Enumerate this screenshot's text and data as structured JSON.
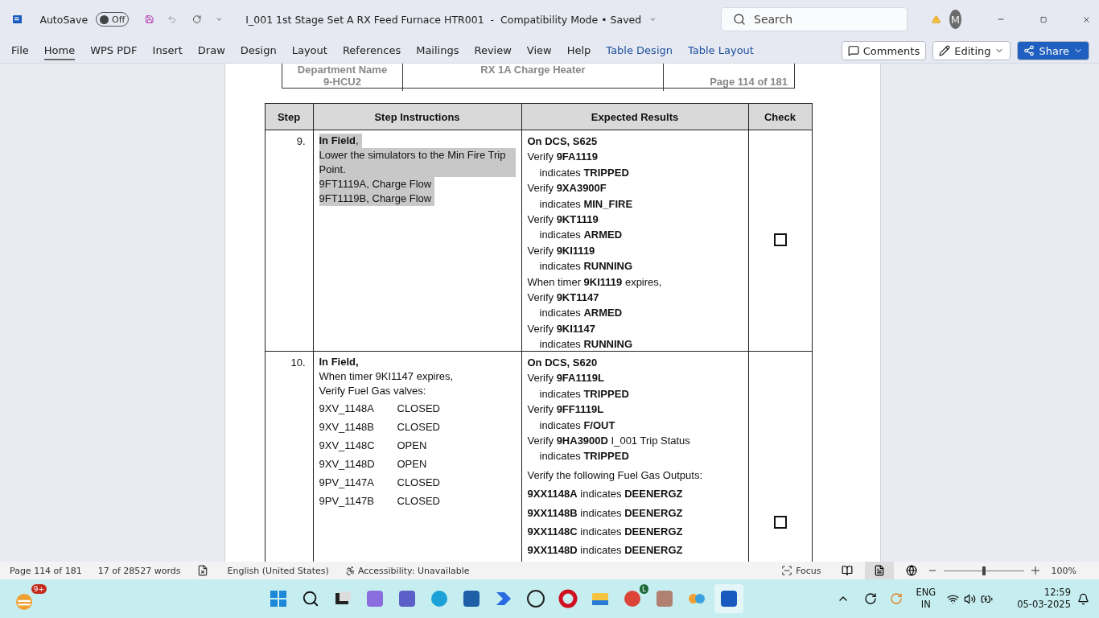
{
  "title_bar": {
    "autosave_label": "AutoSave",
    "autosave_on": false,
    "autosave_state": "Off",
    "document_title": "I_001 1st Stage Set A RX Feed Furnace HTR001  -  Compatibility Mode • Saved",
    "search_placeholder": "Search",
    "avatar": "M"
  },
  "ribbon": {
    "tabs": [
      {
        "label": "File",
        "selected": false,
        "kind": "core"
      },
      {
        "label": "Home",
        "selected": true,
        "kind": "core"
      },
      {
        "label": "WPS PDF",
        "selected": false,
        "kind": "core"
      },
      {
        "label": "Insert",
        "selected": false,
        "kind": "core"
      },
      {
        "label": "Draw",
        "selected": false,
        "kind": "core"
      },
      {
        "label": "Design",
        "selected": false,
        "kind": "core"
      },
      {
        "label": "Layout",
        "selected": false,
        "kind": "core"
      },
      {
        "label": "References",
        "selected": false,
        "kind": "core"
      },
      {
        "label": "Mailings",
        "selected": false,
        "kind": "core"
      },
      {
        "label": "Review",
        "selected": false,
        "kind": "core"
      },
      {
        "label": "View",
        "selected": false,
        "kind": "core"
      },
      {
        "label": "Help",
        "selected": false,
        "kind": "core"
      },
      {
        "label": "Table Design",
        "selected": false,
        "kind": "contextual"
      },
      {
        "label": "Table Layout",
        "selected": false,
        "kind": "contextual"
      }
    ],
    "comments": "Comments",
    "editing": "Editing",
    "share": "Share"
  },
  "header_block": {
    "department_label": "Department Name",
    "department_value": "9-HCU2",
    "title": "RX 1A Charge Heater",
    "page": "Page 114 of 181"
  },
  "table": {
    "columns": [
      "Step",
      "Step Instructions",
      "Expected Results",
      "Check"
    ],
    "rows": [
      {
        "step": "9.",
        "checked": false,
        "instructions": [
          {
            "kind": "text",
            "text": "**In Field**,",
            "highlighted": true
          },
          {
            "kind": "text",
            "text": "Lower the simulators to the Min Fire Trip Point.",
            "highlighted": true
          },
          {
            "kind": "text",
            "text": "9FT1119A, Charge Flow",
            "highlighted": true
          },
          {
            "kind": "text",
            "text": "9FT1119B, Charge Flow",
            "highlighted": true
          }
        ],
        "results": [
          {
            "kind": "line",
            "text": "**On DCS, S625**"
          },
          {
            "kind": "line",
            "text": "Verify **9FA1119**"
          },
          {
            "kind": "sub",
            "text": "indicates **TRIPPED**"
          },
          {
            "kind": "line",
            "text": "Verify **9XA3900F**"
          },
          {
            "kind": "sub",
            "text": "indicates **MIN_FIRE**"
          },
          {
            "kind": "line",
            "text": "Verify **9KT1119**"
          },
          {
            "kind": "sub",
            "text": "indicates **ARMED**"
          },
          {
            "kind": "line",
            "text": "Verify **9KI1119**"
          },
          {
            "kind": "sub",
            "text": "indicates **RUNNING**"
          },
          {
            "kind": "line",
            "text": "When timer **9KI1119** expires,"
          },
          {
            "kind": "line",
            "text": "Verify **9KT1147**"
          },
          {
            "kind": "sub",
            "text": "indicates **ARMED**"
          },
          {
            "kind": "line",
            "text": "Verify **9KI1147**"
          },
          {
            "kind": "sub",
            "text": "indicates **RUNNING**"
          }
        ]
      },
      {
        "step": "10.",
        "checked": false,
        "instructions": [
          {
            "kind": "text",
            "text": "**In Field,**",
            "highlighted": false
          },
          {
            "kind": "text",
            "text": "When timer 9KI1147 expires,",
            "highlighted": false
          },
          {
            "kind": "text",
            "text": "Verify Fuel Gas valves:",
            "highlighted": false
          },
          {
            "kind": "valve",
            "tag": "9XV_1148A",
            "state": "CLOSED"
          },
          {
            "kind": "valve",
            "tag": "9XV_1148B",
            "state": "CLOSED"
          },
          {
            "kind": "valve",
            "tag": "9XV_1148C",
            "state": "OPEN"
          },
          {
            "kind": "valve",
            "tag": "9XV_1148D",
            "state": "OPEN"
          },
          {
            "kind": "valve",
            "tag": "9PV_1147A",
            "state": "CLOSED"
          },
          {
            "kind": "valve",
            "tag": "9PV_1147B",
            "state": "CLOSED"
          }
        ],
        "results": [
          {
            "kind": "line",
            "text": "**On DCS, S620**"
          },
          {
            "kind": "line",
            "text": "Verify **9FA1119L**"
          },
          {
            "kind": "sub",
            "text": "indicates **TRIPPED**"
          },
          {
            "kind": "line",
            "text": "Verify **9FF1119L**"
          },
          {
            "kind": "sub",
            "text": "indicates **F/OUT**"
          },
          {
            "kind": "line",
            "text": "Verify **9HA3900D** I_001 Trip Status"
          },
          {
            "kind": "sub",
            "text": "indicates **TRIPPED**"
          },
          {
            "kind": "gap",
            "text": "Verify the following Fuel Gas Outputs:"
          },
          {
            "kind": "gap",
            "text": "**9XX1148A** indicates **DEENERGZ**"
          },
          {
            "kind": "gap",
            "text": "**9XX1148B** indicates **DEENERGZ**"
          },
          {
            "kind": "gap",
            "text": "**9XX1148C** indicates **DEENERGZ**"
          },
          {
            "kind": "gap",
            "text": "**9XX1148D** indicates **DEENERGZ**"
          }
        ]
      }
    ]
  },
  "status_bar": {
    "page": "Page 114 of 181",
    "words": "17 of 28527 words",
    "language": "English (United States)",
    "accessibility": "Accessibility: Unavailable",
    "focus": "Focus",
    "zoom": "100%",
    "zoom_level": {
      "level": 0.5
    }
  },
  "taskbar": {
    "badge": "9+",
    "chrome_badge": "L",
    "language": "ENG",
    "region": "IN",
    "time": "12:59",
    "date": "05-03-2025"
  }
}
